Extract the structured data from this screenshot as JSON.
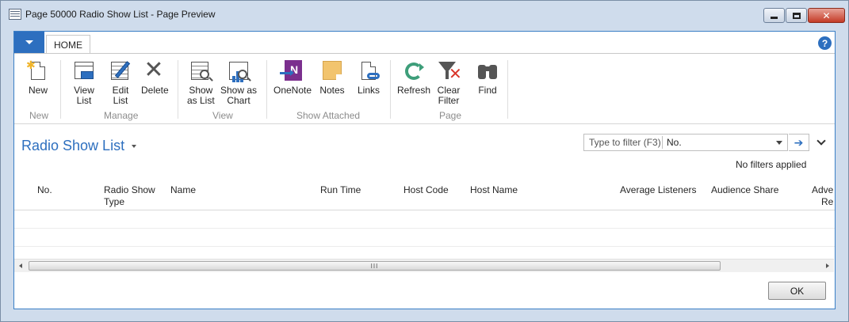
{
  "window": {
    "title": "Page 50000 Radio Show List - Page Preview",
    "icon": "table-icon"
  },
  "ribbon": {
    "tab": "HOME",
    "groups": {
      "new": {
        "label": "New",
        "buttons": {
          "new": "New"
        }
      },
      "manage": {
        "label": "Manage",
        "buttons": {
          "view_list": "View\nList",
          "edit_list": "Edit\nList",
          "delete": "Delete"
        }
      },
      "view": {
        "label": "View",
        "buttons": {
          "show_as_list": "Show\nas List",
          "show_as_chart": "Show as\nChart"
        }
      },
      "show_attached": {
        "label": "Show Attached",
        "buttons": {
          "onenote": "OneNote",
          "notes": "Notes",
          "links": "Links"
        }
      },
      "page": {
        "label": "Page",
        "buttons": {
          "refresh": "Refresh",
          "clear_filter": "Clear\nFilter",
          "find": "Find"
        }
      }
    }
  },
  "page": {
    "title": "Radio Show List",
    "filter": {
      "placeholder": "Type to filter (F3)",
      "field": "No.",
      "status": "No filters applied"
    }
  },
  "grid": {
    "columns": [
      "No.",
      "Radio Show\nType",
      "Name",
      "Run Time",
      "Host Code",
      "Host Name",
      "Average Listeners",
      "Audience Share",
      "Adve\nRe"
    ]
  },
  "scrollbar": {
    "thumb_grip": "III"
  },
  "footer": {
    "ok_label": "OK"
  },
  "colors": {
    "accent": "#2d6fbf",
    "frame": "#cfdcec"
  }
}
